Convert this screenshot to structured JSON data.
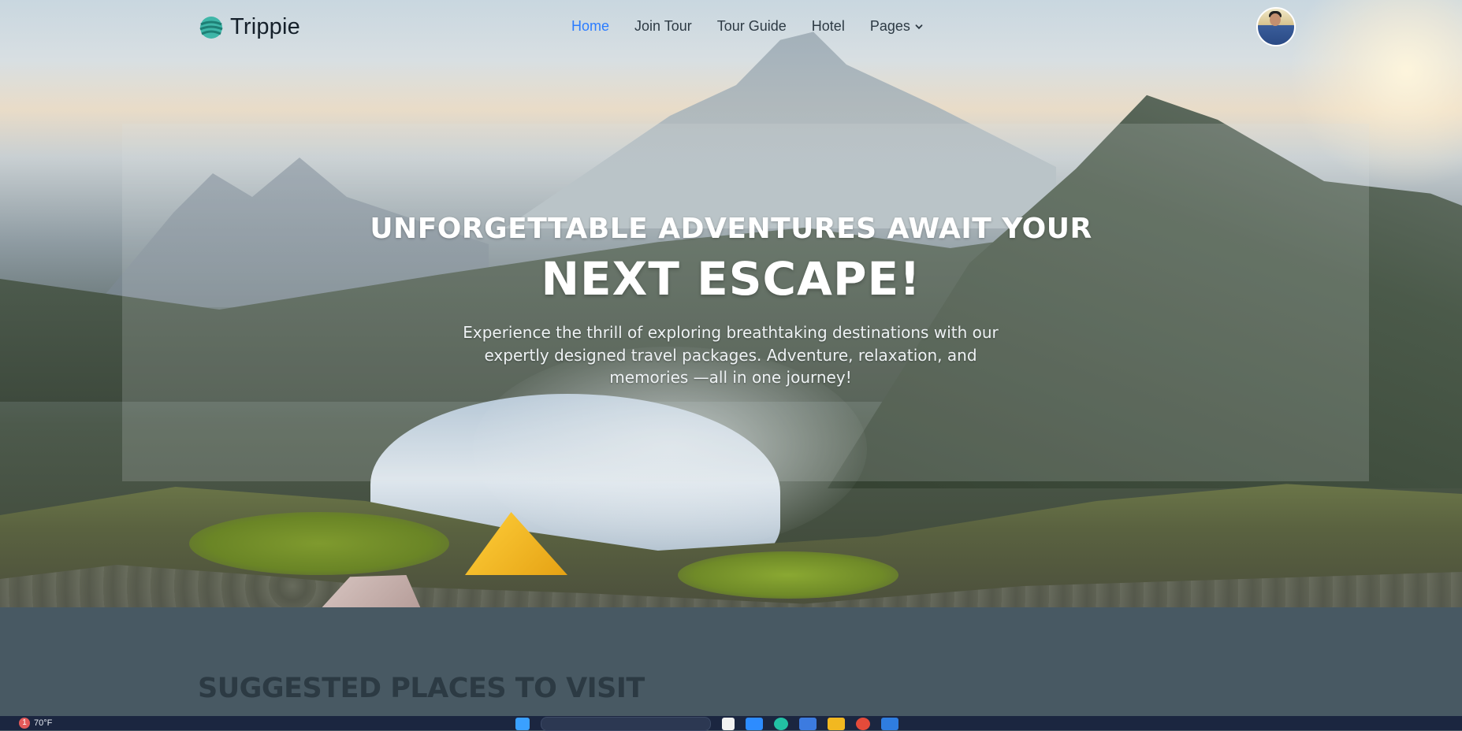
{
  "brand": {
    "name": "Trippie",
    "logo_icon": "globe-icon"
  },
  "nav": {
    "items": [
      {
        "label": "Home",
        "active": true
      },
      {
        "label": "Join Tour",
        "active": false
      },
      {
        "label": "Tour Guide",
        "active": false
      },
      {
        "label": "Hotel",
        "active": false
      },
      {
        "label": "Pages",
        "active": false,
        "has_dropdown": true
      }
    ],
    "active_color": "#2b7cff"
  },
  "user": {
    "avatar_icon": "user-avatar"
  },
  "hero": {
    "headline": "UNFORGETTABLE ADVENTURES AWAIT YOUR",
    "headline_emphasis": "NEXT ESCAPE!",
    "lead": "Experience the thrill of exploring breathtaking destinations with our expertly designed travel packages. Adventure, relaxation, and memories —all in one journey!"
  },
  "section": {
    "title": "SUGGESTED PLACES TO VISIT"
  },
  "taskbar": {
    "weather_badge": "1",
    "temperature": "70°F"
  }
}
